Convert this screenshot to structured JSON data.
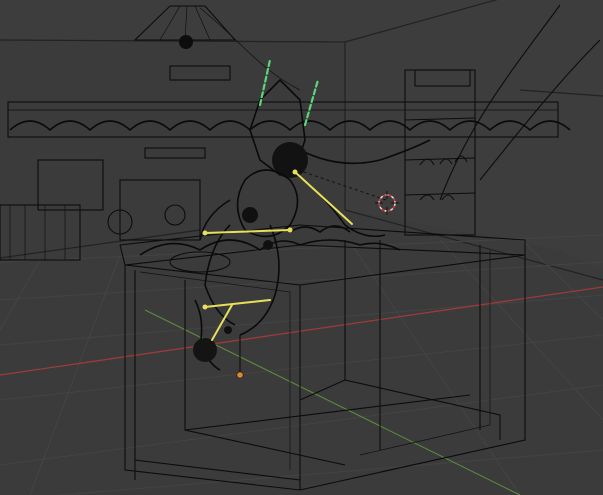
{
  "viewport": {
    "view_type": "3d-viewport-wireframe",
    "background_color": "#3b3b3b",
    "grid_color": "#474747",
    "axis_x_color": "#9c3b3b",
    "axis_y_color": "#5f8a3c",
    "wireframe_color": "#0c0c0c",
    "selected_bone_color": "#e8e05a",
    "bone_green_color": "#5bd67c",
    "cursor_icon": "3d-cursor-icon",
    "origin_icon": "object-origin-icon",
    "origin_color": "#e08a2e"
  }
}
